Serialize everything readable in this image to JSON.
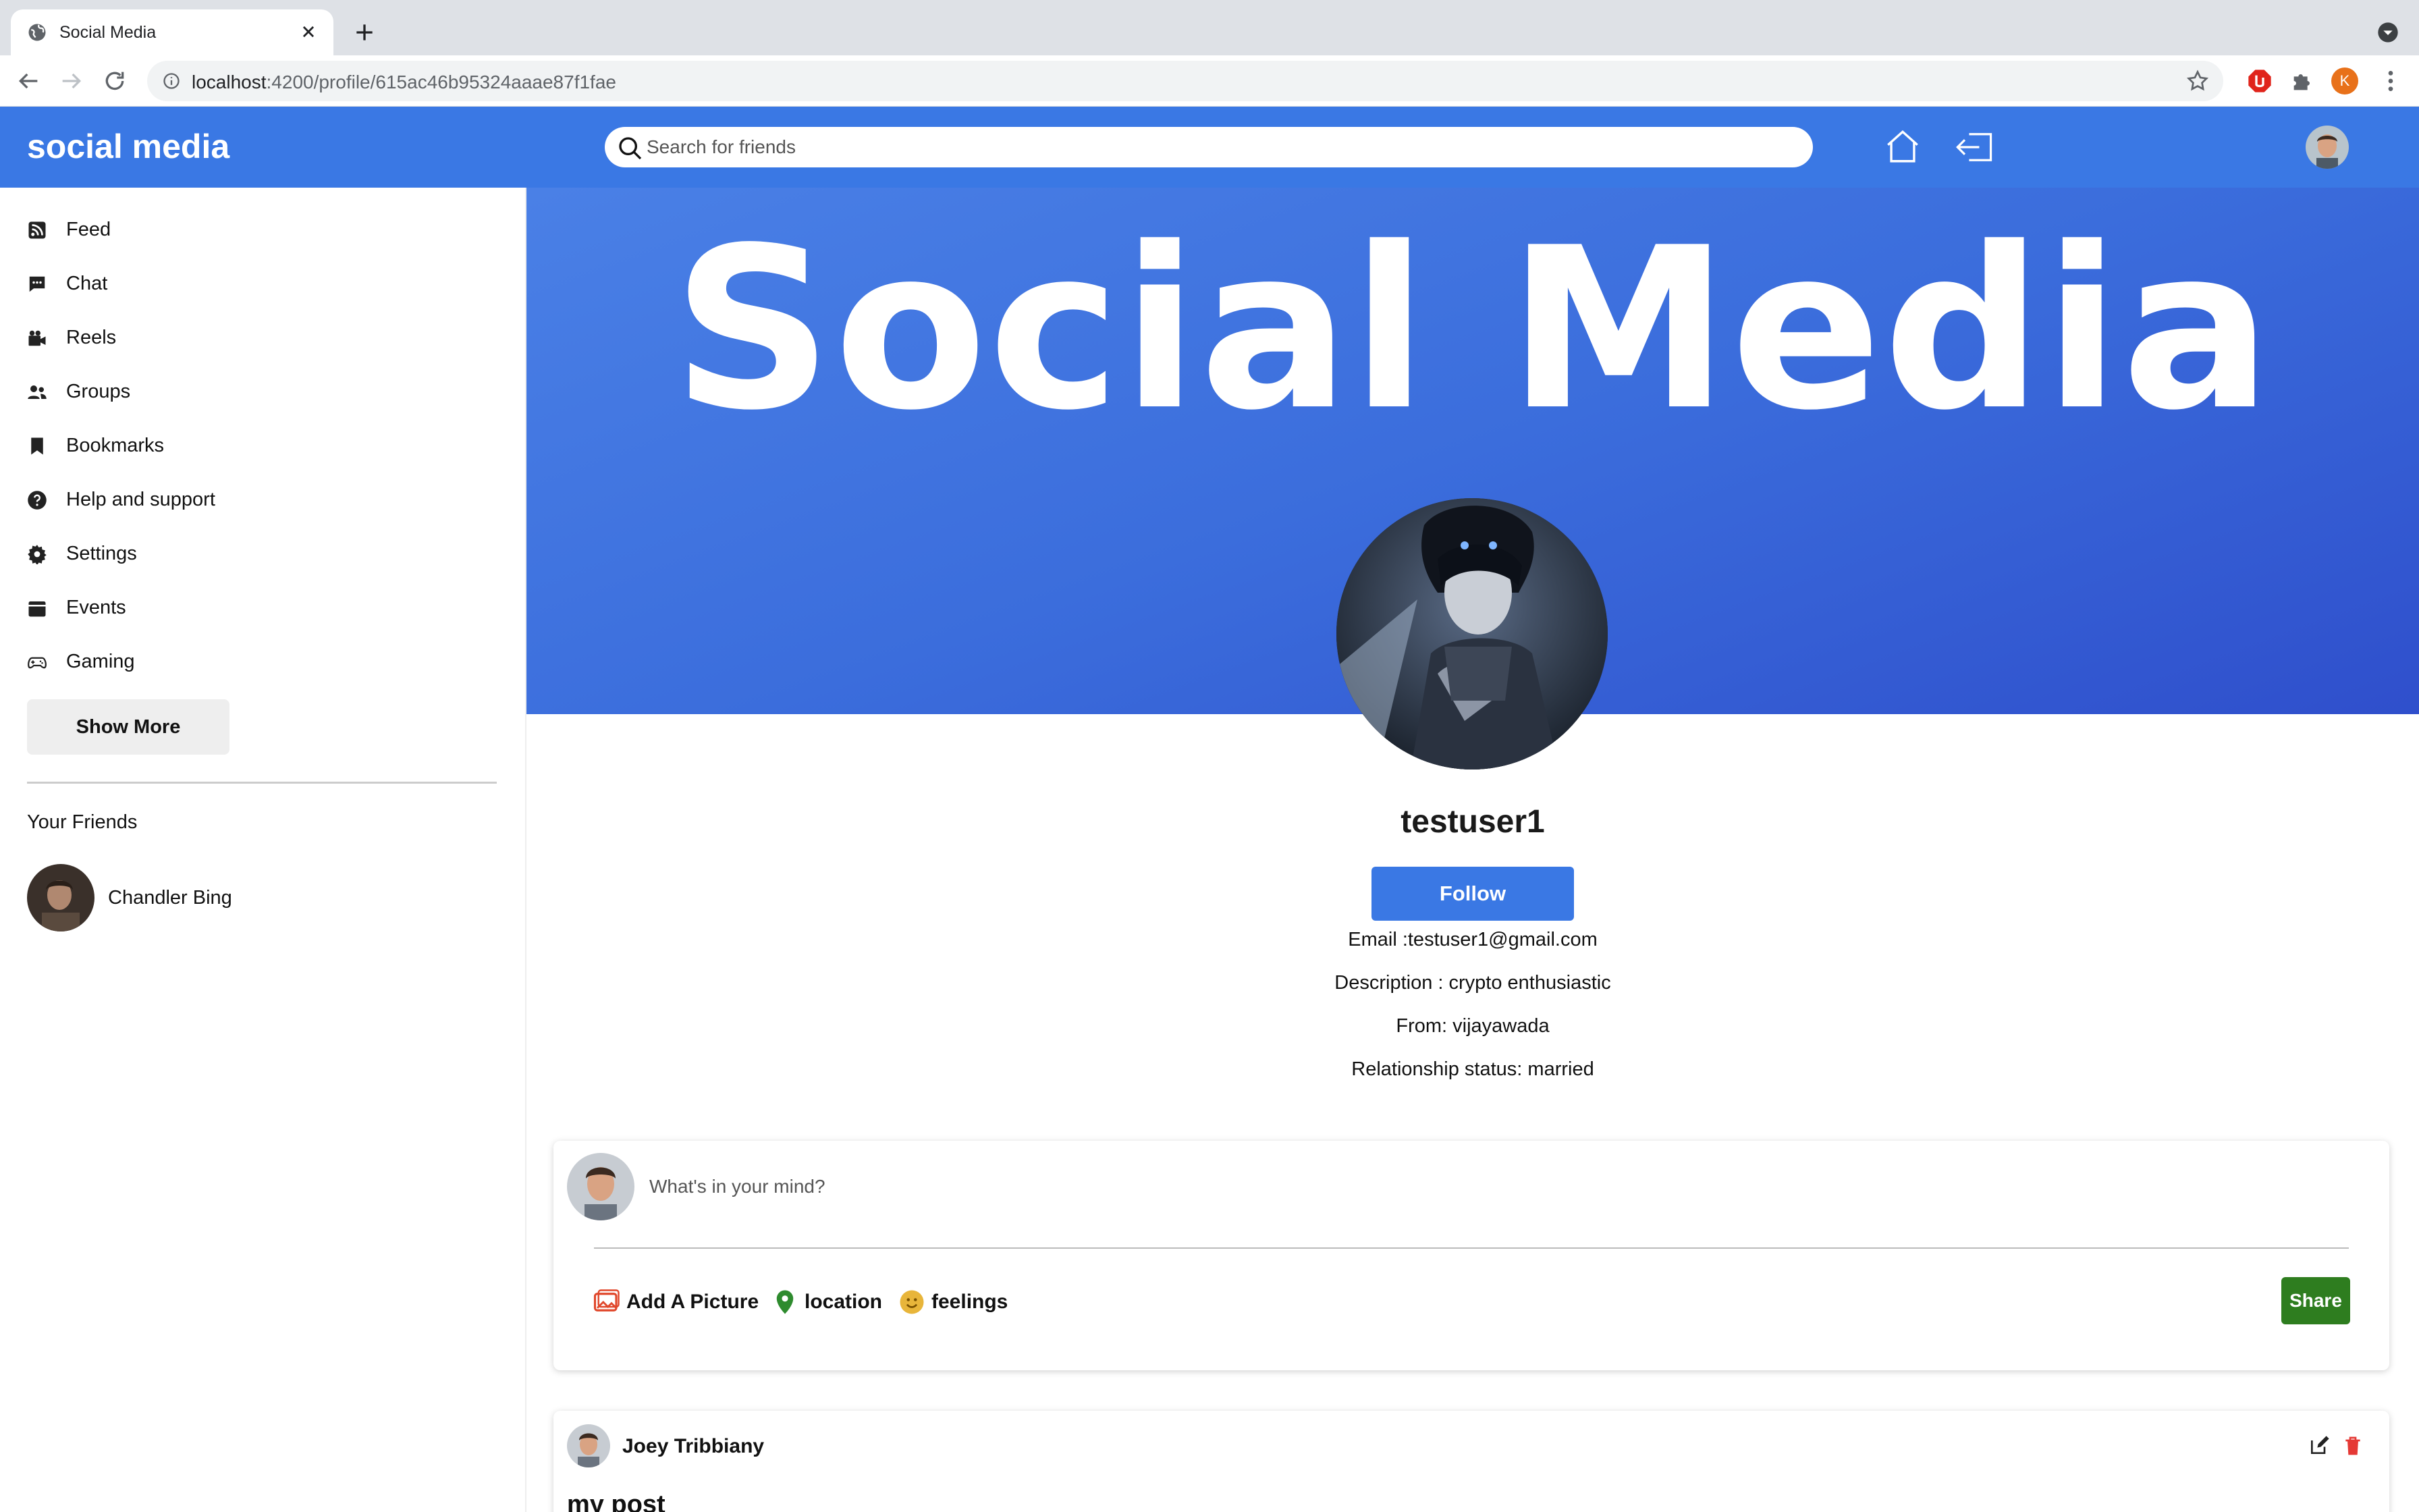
{
  "browser": {
    "tab_title": "Social Media",
    "url_host": "localhost",
    "url_path": ":4200/profile/615ac46b95324aaae87f1fae",
    "profile_initial": "K"
  },
  "navbar": {
    "brand": "social media",
    "search_placeholder": "Search for friends"
  },
  "sidebar": {
    "items": [
      {
        "label": "Feed",
        "icon": "rss-icon"
      },
      {
        "label": "Chat",
        "icon": "chat-icon"
      },
      {
        "label": "Reels",
        "icon": "video-camera-icon"
      },
      {
        "label": "Groups",
        "icon": "group-icon"
      },
      {
        "label": "Bookmarks",
        "icon": "bookmark-icon"
      },
      {
        "label": "Help and support",
        "icon": "help-icon"
      },
      {
        "label": "Settings",
        "icon": "gear-icon"
      },
      {
        "label": "Events",
        "icon": "calendar-icon"
      },
      {
        "label": "Gaming",
        "icon": "gamepad-icon"
      }
    ],
    "show_more": "Show More",
    "friends_title": "Your Friends",
    "friends": [
      {
        "name": "Chandler Bing"
      }
    ]
  },
  "profile": {
    "cover_text": "Social Media",
    "username": "testuser1",
    "follow_label": "Follow",
    "email_line": "Email :testuser1@gmail.com",
    "description_line": "Description : crypto enthusiastic",
    "from_line": "From: vijayawada",
    "relationship_line": "Relationship status: married"
  },
  "composer": {
    "placeholder": "What's in your mind?",
    "add_picture": "Add A Picture",
    "location": "location",
    "feelings": "feelings",
    "share": "Share"
  },
  "post": {
    "author": "Joey Tribbiany",
    "text": "my post"
  },
  "colors": {
    "primary": "#3a78e4",
    "share_green": "#2e7d1f",
    "delete_red": "#e53935"
  }
}
